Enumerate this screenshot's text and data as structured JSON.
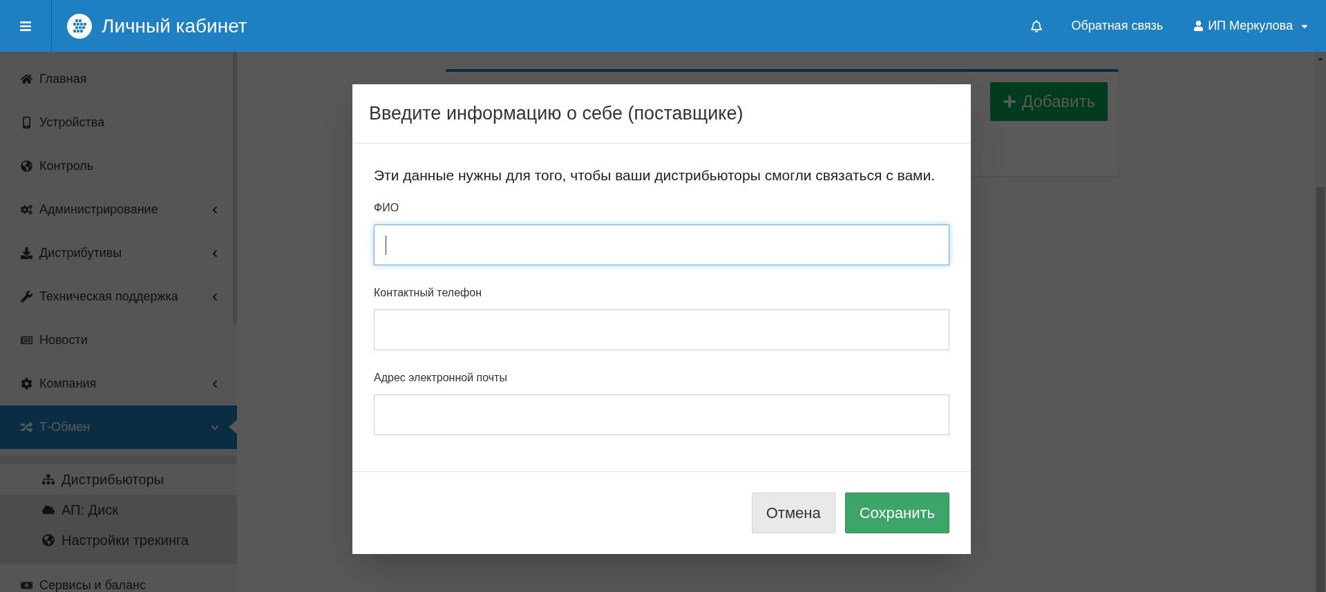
{
  "header": {
    "title": "Личный кабинет",
    "feedback": "Обратная связь",
    "user": "ИП Меркулова"
  },
  "sidebar": {
    "items": [
      {
        "label": "Главная"
      },
      {
        "label": "Устройства"
      },
      {
        "label": "Контроль"
      },
      {
        "label": "Администрирование",
        "expanded": false
      },
      {
        "label": "Дистрибутивы",
        "expanded": false
      },
      {
        "label": "Техническая поддержка",
        "expanded": false
      },
      {
        "label": "Новости"
      },
      {
        "label": "Компания",
        "expanded": false
      },
      {
        "label": "Т-Обмен",
        "expanded": true,
        "selected": true,
        "children": [
          {
            "label": "Дистрибьюторы",
            "selected": true
          },
          {
            "label": "АП: Диск",
            "selected": false
          },
          {
            "label": "Настройки трекинга",
            "selected": false
          }
        ]
      },
      {
        "label": "Сервисы и баланс"
      }
    ]
  },
  "page": {
    "add_button": "Добавить"
  },
  "modal": {
    "title": "Введите информацию о себе (поставщике)",
    "description": "Эти данные нужны для того, чтобы ваши дистрибьюторы смогли связаться с вами.",
    "fields": [
      {
        "label": "ФИО",
        "focused": true
      },
      {
        "label": "Контактный телефон",
        "focused": false
      },
      {
        "label": "Адрес электронной почты",
        "focused": false
      }
    ],
    "buttons": [
      {
        "label": "Отмена",
        "kind": "secondary"
      },
      {
        "label": "Сохранить",
        "kind": "primary"
      }
    ]
  }
}
